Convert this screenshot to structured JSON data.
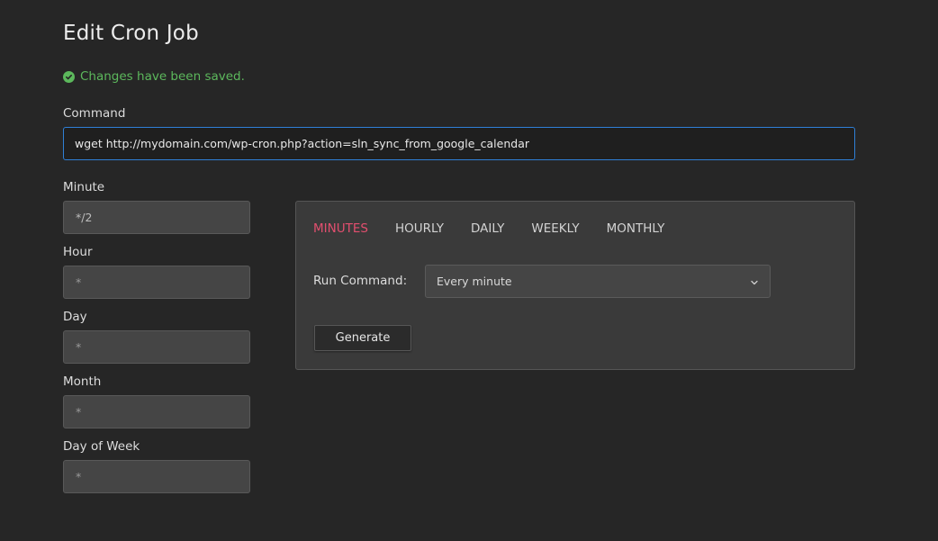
{
  "page": {
    "title": "Edit Cron Job"
  },
  "notice": {
    "text": "Changes have been saved.",
    "icon": "check-circle-icon",
    "color": "#5cb85c"
  },
  "command": {
    "label": "Command",
    "value": "wget http://mydomain.com/wp-cron.php?action=sln_sync_from_google_calendar"
  },
  "fields": {
    "minute": {
      "label": "Minute",
      "value": "*/2"
    },
    "hour": {
      "label": "Hour",
      "placeholder": "*"
    },
    "day": {
      "label": "Day",
      "placeholder": "*"
    },
    "month": {
      "label": "Month",
      "placeholder": "*"
    },
    "day_of_week": {
      "label": "Day of Week",
      "placeholder": "*"
    }
  },
  "generator": {
    "tabs": [
      {
        "label": "MINUTES",
        "active": true
      },
      {
        "label": "HOURLY",
        "active": false
      },
      {
        "label": "DAILY",
        "active": false
      },
      {
        "label": "WEEKLY",
        "active": false
      },
      {
        "label": "MONTHLY",
        "active": false
      }
    ],
    "run_label": "Run Command:",
    "select_value": "Every minute",
    "generate_label": "Generate",
    "active_tab_color": "#e34f6f"
  }
}
